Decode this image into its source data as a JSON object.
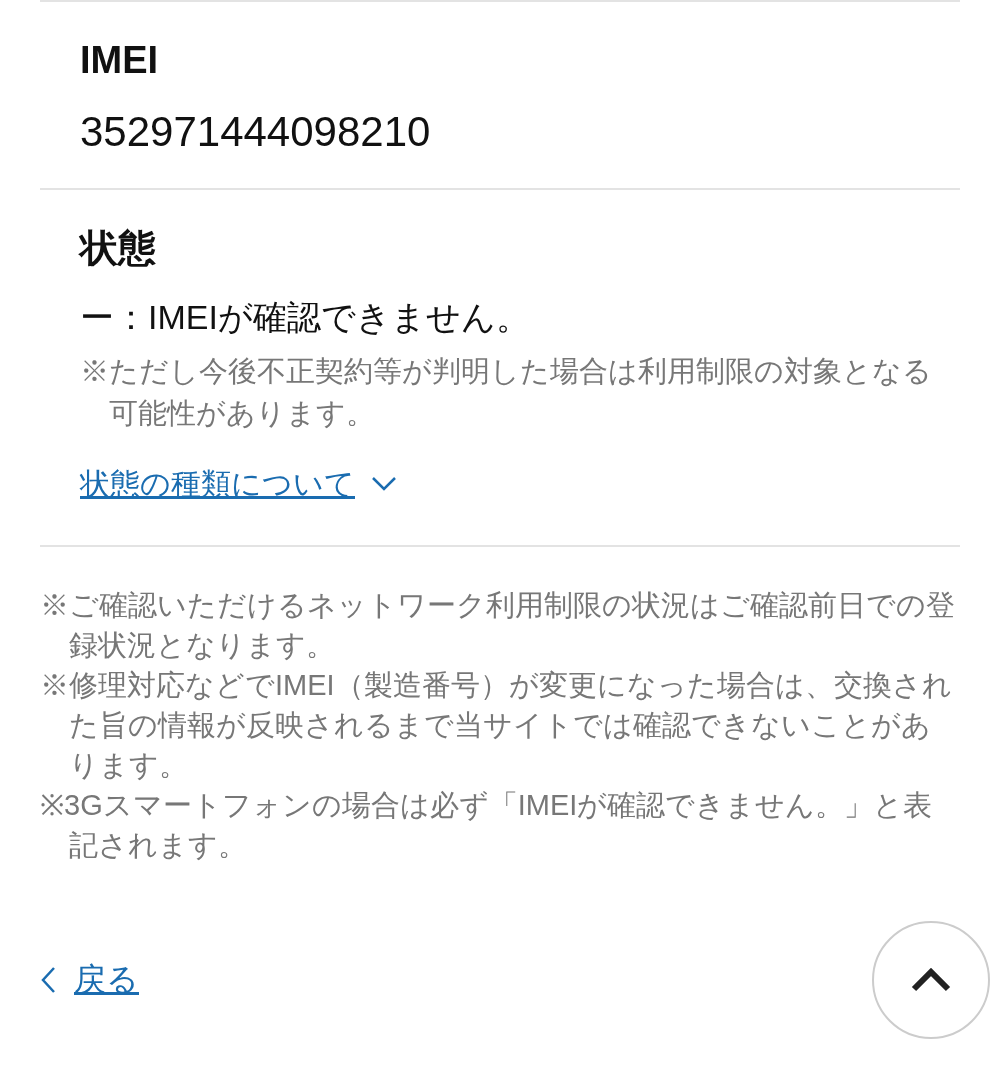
{
  "fields": [
    {
      "label": "IMEI",
      "value": "352971444098210"
    },
    {
      "label": "状態",
      "value": "ー：IMEIが確認できません。",
      "note": "※ただし今後不正契約等が判明した場合は利用制限の対象となる可能性があります。",
      "link": "状態の種類について"
    }
  ],
  "notes": [
    "※ご確認いただけるネットワーク利用制限の状況はご確認前日での登録状況となります。",
    "※修理対応などでIMEI（製造番号）が変更になった場合は、交換された旨の情報が反映されるまで当サイトでは確認できないことがあります。",
    "※3Gスマートフォンの場合は必ず「IMEIが確認できません。」と表記されます。"
  ],
  "back_link": "戻る"
}
